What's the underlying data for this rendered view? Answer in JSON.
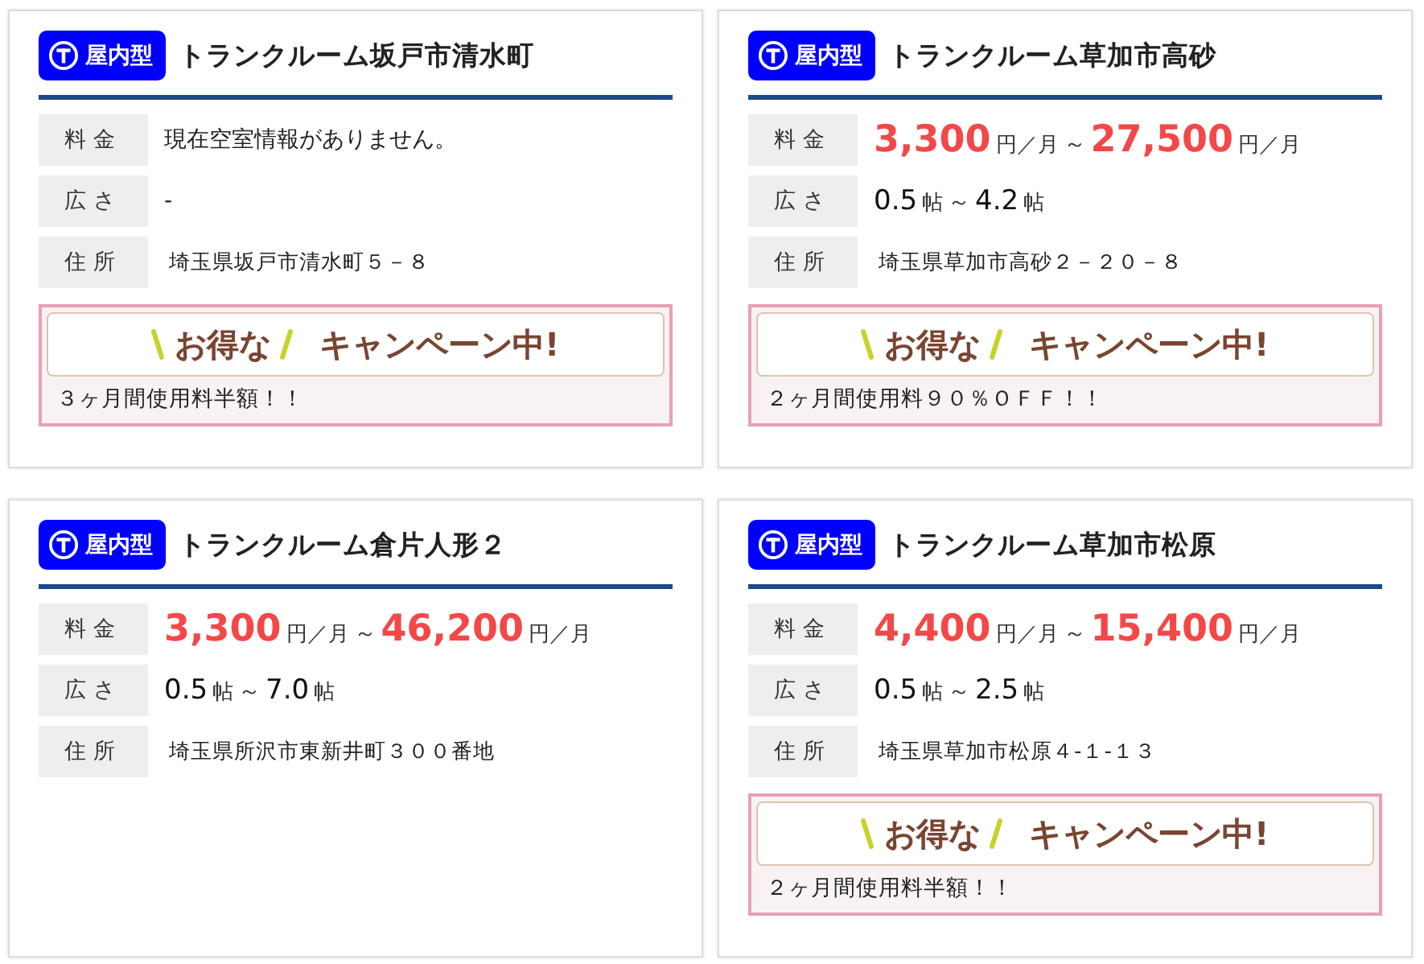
{
  "cards": [
    {
      "badge": "屋内型",
      "title": "トランクルーム坂戸市清水町",
      "rows": [
        {
          "label": "料金",
          "kind": "text",
          "value": "現在空室情報がありません。"
        },
        {
          "label": "広さ",
          "kind": "text",
          "value": "-"
        },
        {
          "label": "住所",
          "kind": "address",
          "value": "埼玉県坂戸市清水町５－８"
        }
      ],
      "campaign": {
        "lead": "お得な",
        "main": "キャンペーン中!",
        "note": "３ヶ月間使用料半額！！"
      }
    },
    {
      "badge": "屋内型",
      "title": "トランクルーム草加市高砂",
      "rows": [
        {
          "label": "料金",
          "kind": "range",
          "parts": [
            {
              "kind": "price",
              "text": "3,300"
            },
            {
              "kind": "unit",
              "text": "円／月"
            },
            {
              "kind": "sep",
              "text": "～"
            },
            {
              "kind": "price",
              "text": "27,500"
            },
            {
              "kind": "unit",
              "text": "円／月"
            }
          ]
        },
        {
          "label": "広さ",
          "kind": "range",
          "parts": [
            {
              "kind": "figure",
              "text": "0.5"
            },
            {
              "kind": "unit",
              "text": "帖"
            },
            {
              "kind": "sep",
              "text": "～"
            },
            {
              "kind": "figure",
              "text": "4.2"
            },
            {
              "kind": "unit",
              "text": "帖"
            }
          ]
        },
        {
          "label": "住所",
          "kind": "address",
          "value": "埼玉県草加市高砂２－２０－８"
        }
      ],
      "campaign": {
        "lead": "お得な",
        "main": "キャンペーン中!",
        "note": "２ヶ月間使用料９０％ＯＦＦ！！"
      }
    },
    {
      "badge": "屋内型",
      "title": "トランクルーム倉片人形２",
      "rows": [
        {
          "label": "料金",
          "kind": "range",
          "parts": [
            {
              "kind": "price",
              "text": "3,300"
            },
            {
              "kind": "unit",
              "text": "円／月"
            },
            {
              "kind": "sep",
              "text": "～"
            },
            {
              "kind": "price",
              "text": "46,200"
            },
            {
              "kind": "unit",
              "text": "円／月"
            }
          ]
        },
        {
          "label": "広さ",
          "kind": "range",
          "parts": [
            {
              "kind": "figure",
              "text": "0.5"
            },
            {
              "kind": "unit",
              "text": "帖"
            },
            {
              "kind": "sep",
              "text": "～"
            },
            {
              "kind": "figure",
              "text": "7.0"
            },
            {
              "kind": "unit",
              "text": "帖"
            }
          ]
        },
        {
          "label": "住所",
          "kind": "address",
          "value": "埼玉県所沢市東新井町３００番地"
        }
      ]
    },
    {
      "badge": "屋内型",
      "title": "トランクルーム草加市松原",
      "rows": [
        {
          "label": "料金",
          "kind": "range",
          "parts": [
            {
              "kind": "price",
              "text": "4,400"
            },
            {
              "kind": "unit",
              "text": "円／月"
            },
            {
              "kind": "sep",
              "text": "～"
            },
            {
              "kind": "price",
              "text": "15,400"
            },
            {
              "kind": "unit",
              "text": "円／月"
            }
          ]
        },
        {
          "label": "広さ",
          "kind": "range",
          "parts": [
            {
              "kind": "figure",
              "text": "0.5"
            },
            {
              "kind": "unit",
              "text": "帖"
            },
            {
              "kind": "sep",
              "text": "～"
            },
            {
              "kind": "figure",
              "text": "2.5"
            },
            {
              "kind": "unit",
              "text": "帖"
            }
          ]
        },
        {
          "label": "住所",
          "kind": "address",
          "value": "埼玉県草加市松原４-１-１３"
        }
      ],
      "campaign": {
        "lead": "お得な",
        "main": "キャンペーン中!",
        "note": "２ヶ月間使用料半額！！"
      }
    }
  ]
}
